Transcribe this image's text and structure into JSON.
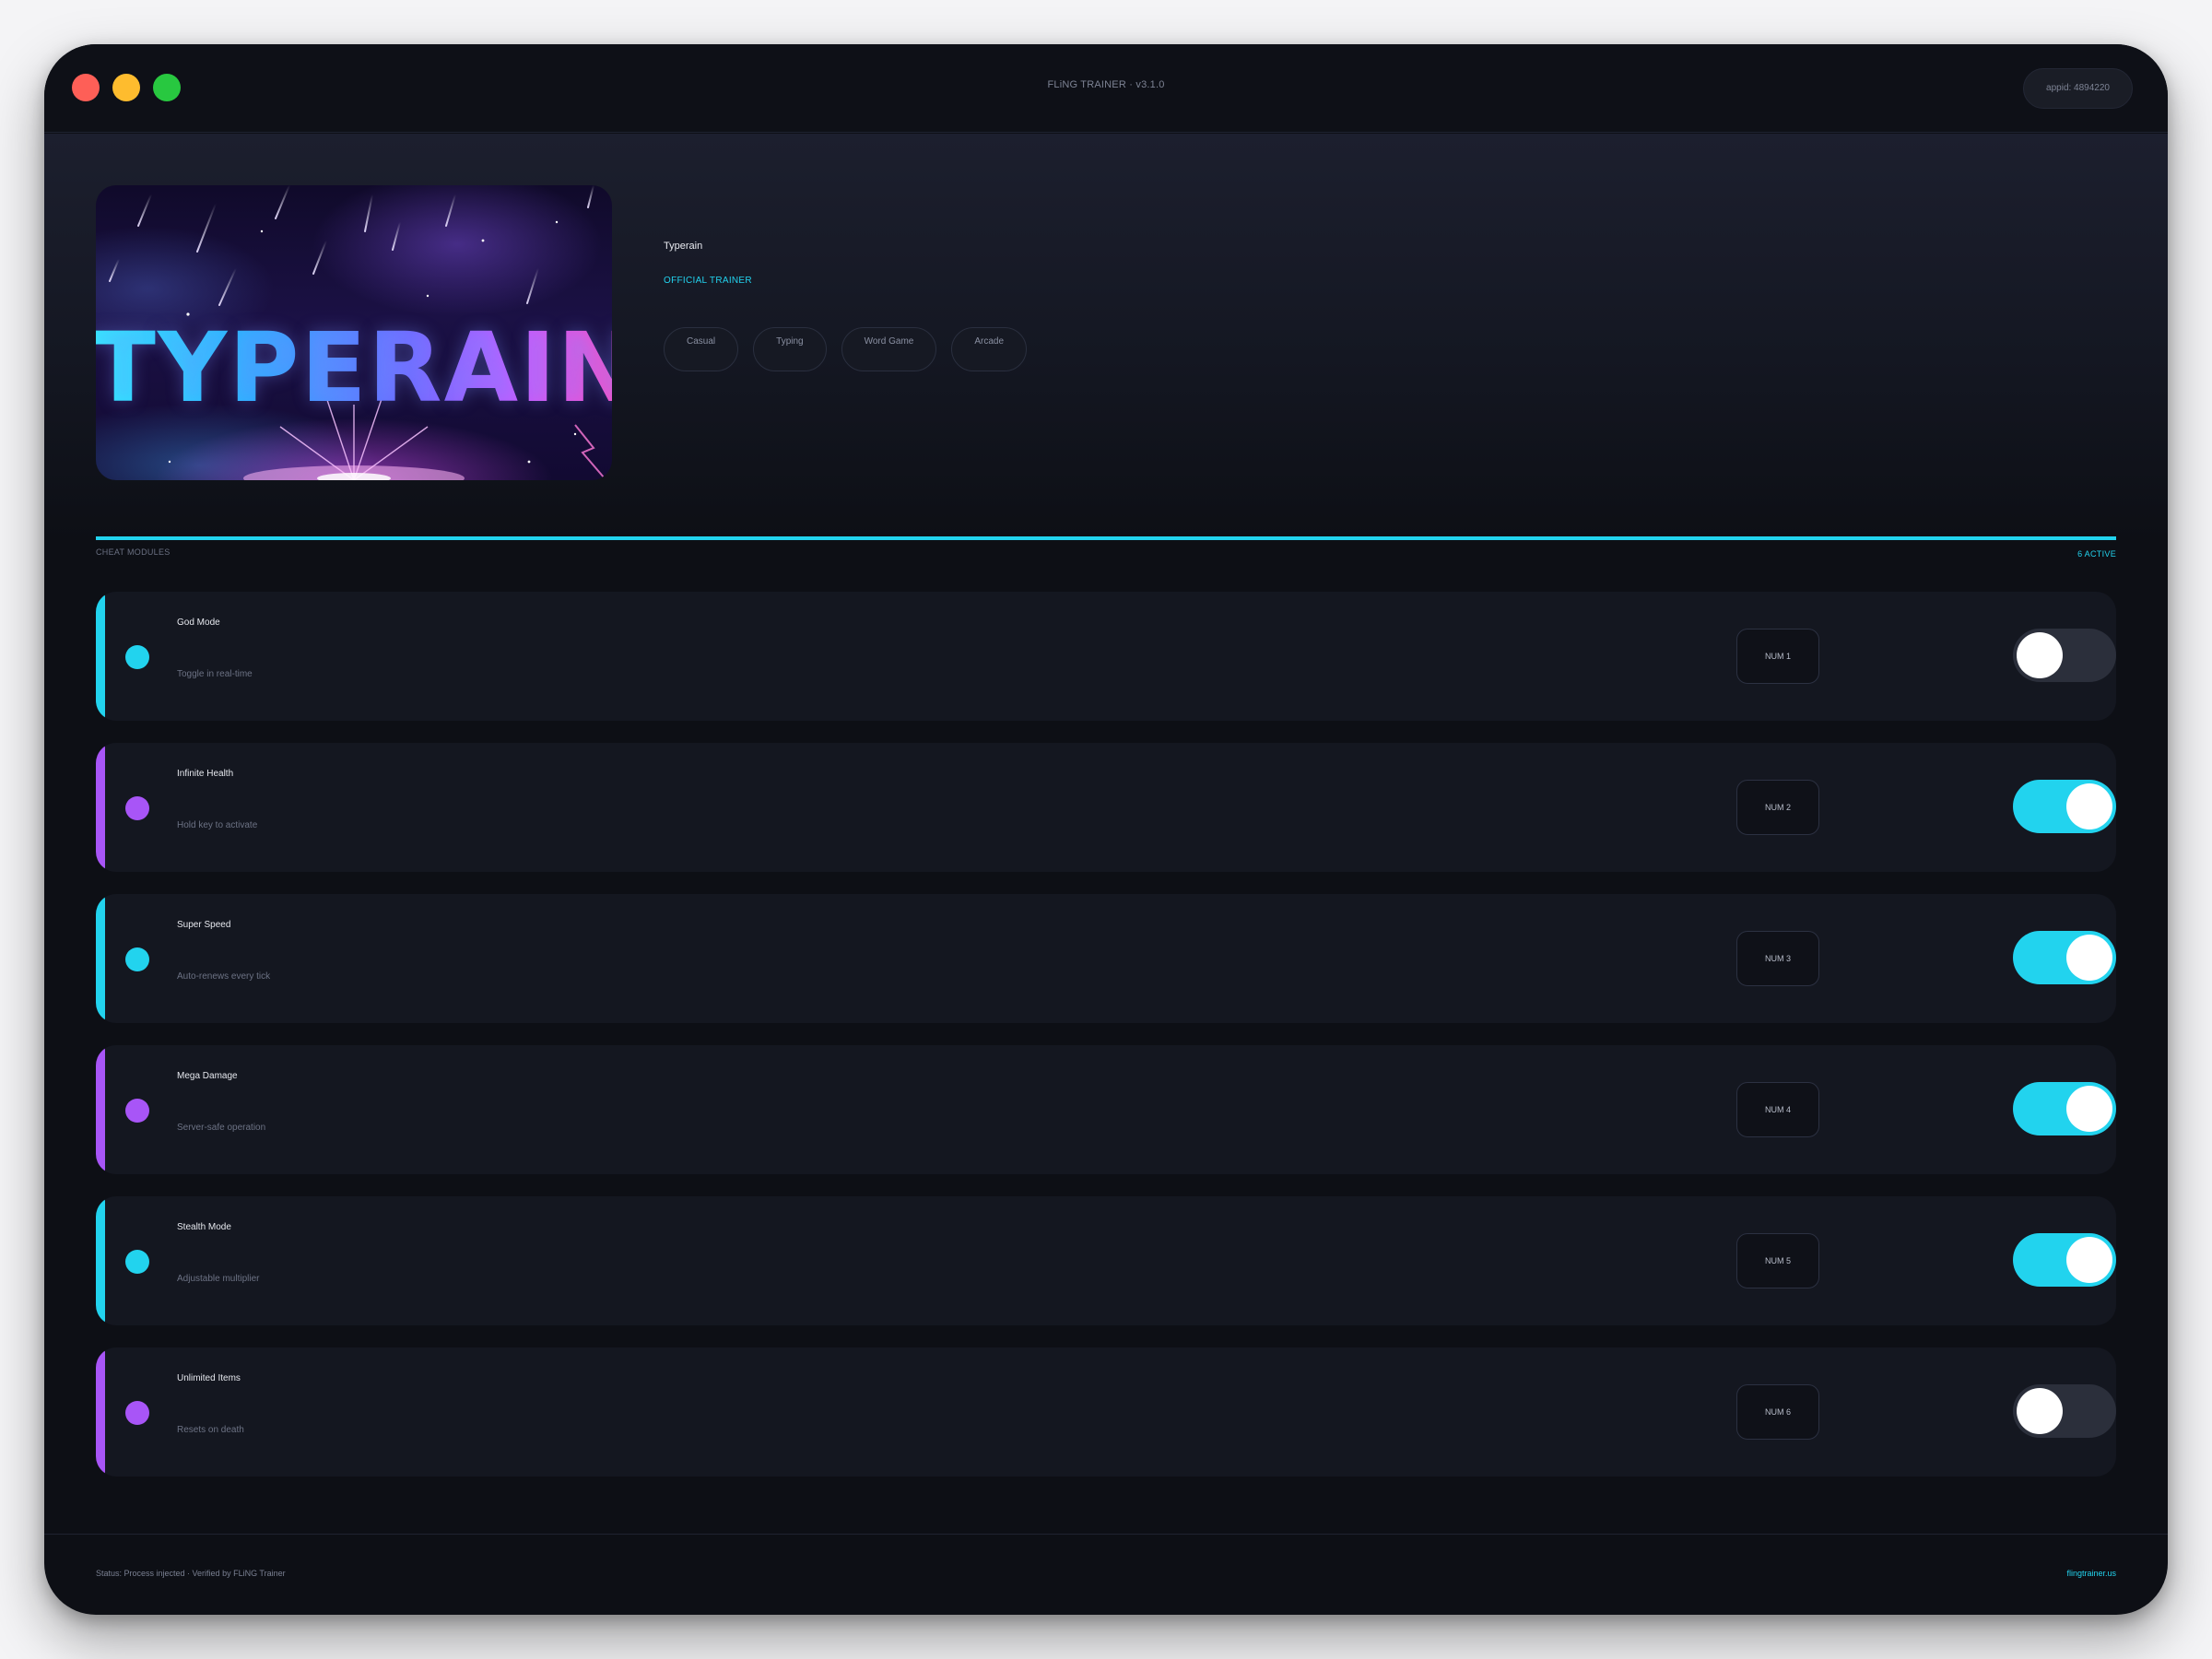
{
  "window": {
    "title": "FLiNG TRAINER · v3.1.0",
    "appid": "appid: 4894220"
  },
  "game": {
    "cover_text": "TYPERAIN",
    "title": "Typerain",
    "badge": "OFFICIAL TRAINER",
    "tags": [
      "Casual",
      "Typing",
      "Word Game",
      "Arcade"
    ]
  },
  "section": {
    "label": "CHEAT MODULES",
    "active_count": "6 ACTIVE"
  },
  "colors": {
    "cyan": "#22d3ee",
    "purple": "#a855f7",
    "toggle_off": "#2b2f3b"
  },
  "cheats": [
    {
      "name": "God Mode",
      "desc": "Toggle in real-time",
      "hotkey": "NUM 1",
      "enabled": false,
      "accent": "cyan"
    },
    {
      "name": "Infinite Health",
      "desc": "Hold key to activate",
      "hotkey": "NUM 2",
      "enabled": true,
      "accent": "purple"
    },
    {
      "name": "Super Speed",
      "desc": "Auto-renews every tick",
      "hotkey": "NUM 3",
      "enabled": true,
      "accent": "cyan"
    },
    {
      "name": "Mega Damage",
      "desc": "Server-safe operation",
      "hotkey": "NUM 4",
      "enabled": true,
      "accent": "purple"
    },
    {
      "name": "Stealth Mode",
      "desc": "Adjustable multiplier",
      "hotkey": "NUM 5",
      "enabled": true,
      "accent": "cyan"
    },
    {
      "name": "Unlimited Items",
      "desc": "Resets on death",
      "hotkey": "NUM 6",
      "enabled": false,
      "accent": "purple"
    }
  ],
  "footer": {
    "status": "Status: Process injected · Verified by FLiNG Trainer",
    "link": "flingtrainer.us"
  }
}
